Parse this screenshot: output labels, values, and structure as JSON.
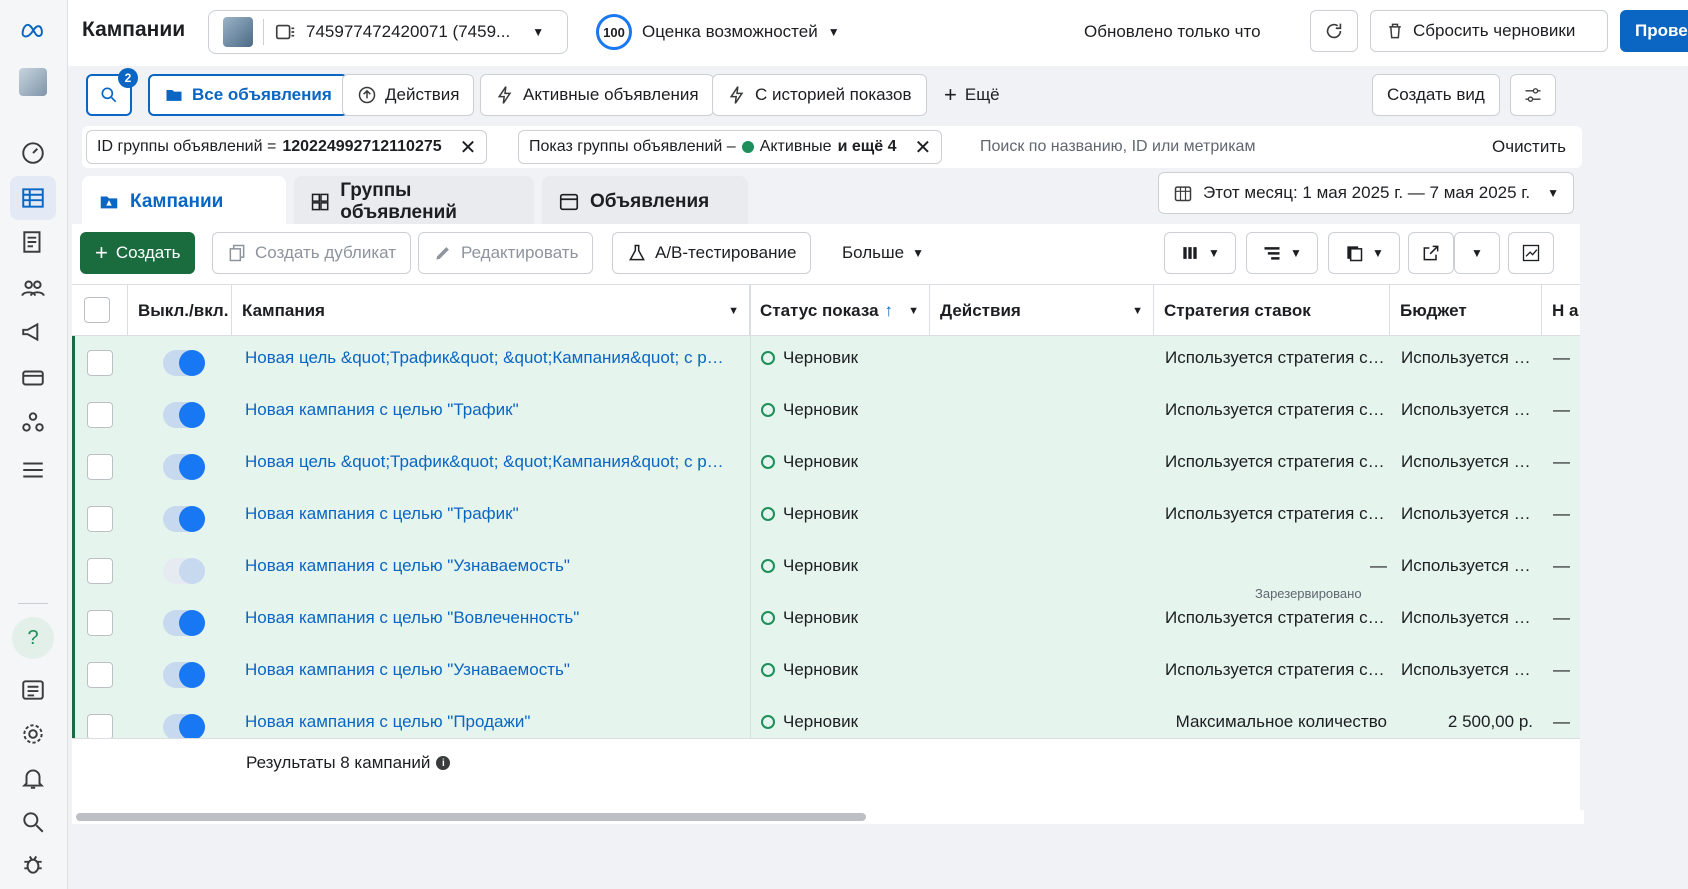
{
  "rail": {
    "items": [
      "meta-logo-icon",
      "account-avatar",
      "dashboard-icon",
      "table-icon",
      "pages-icon",
      "audience-icon",
      "megaphone-icon",
      "billing-icon",
      "business-icon",
      "menu-icon",
      "help-icon",
      "news-icon",
      "gear-icon",
      "bell-icon",
      "search-icon",
      "bug-icon"
    ]
  },
  "header": {
    "title": "Кампании",
    "account": "745977472420071 (7459...",
    "score": "100",
    "score_label": "Оценка возможностей",
    "updated": "Обновлено только что",
    "discard_label": "Сбросить черновики",
    "review_label": "Проверит"
  },
  "views": {
    "search_badge": "2",
    "chips": [
      "Все объявления",
      "Действия",
      "Активные объявления",
      "С историей показов",
      "Ещё"
    ],
    "create_view": "Создать вид"
  },
  "filters": {
    "chip1_label": "ID группы объявлений =",
    "chip1_value": "120224992712110275",
    "chip2_label": "Показ группы объявлений –",
    "chip2_active": "Активные",
    "chip2_more": "и ещё 4",
    "search_placeholder": "Поиск по названию, ID или метрикам",
    "clear": "Очистить"
  },
  "tabs": [
    "Кампании",
    "Группы объявлений",
    "Объявления"
  ],
  "daterange": "Этот месяц: 1 мая 2025 г. — 7 мая 2025 г.",
  "toolbar": {
    "create": "Создать",
    "duplicate": "Создать дубликат",
    "edit": "Редактировать",
    "ab_test": "A/B-тестирование",
    "more": "Больше"
  },
  "table": {
    "headers": [
      "Выкл./вкл.",
      "Кампания",
      "Статус показа",
      "Действия",
      "Стратегия ставок",
      "Бюджет",
      "Н а"
    ],
    "rows": [
      {
        "name": "Новая цель &quot;Трафик&quot; &quot;Кампания&quot; с реко...",
        "status": "Черновик",
        "strategy": "Используется стратегия ст...",
        "budget": "Используется б...",
        "on": true
      },
      {
        "name": "Новая кампания с целью \"Трафик\"",
        "status": "Черновик",
        "strategy": "Используется стратегия ст...",
        "budget": "Используется б...",
        "on": true
      },
      {
        "name": "Новая цель &quot;Трафик&quot; &quot;Кампания&quot; с реко...",
        "status": "Черновик",
        "strategy": "Используется стратегия ст...",
        "budget": "Используется б...",
        "on": true
      },
      {
        "name": "Новая кампания с целью \"Трафик\"",
        "status": "Черновик",
        "strategy": "Используется стратегия ст...",
        "budget": "Используется б...",
        "on": true
      },
      {
        "name": "Новая кампания с целью \"Узнаваемость\"",
        "status": "Черновик",
        "strategy": "—",
        "strategy_note": "Зарезервировано",
        "budget": "Используется б...",
        "on": false
      },
      {
        "name": "Новая кампания с целью \"Вовлеченность\"",
        "status": "Черновик",
        "strategy": "Используется стратегия ст...",
        "budget": "Используется б...",
        "on": true
      },
      {
        "name": "Новая кампания с целью \"Узнаваемость\"",
        "status": "Черновик",
        "strategy": "Используется стратегия ст...",
        "budget": "Используется б...",
        "on": true
      },
      {
        "name": "Новая кампания с целью \"Продажи\"",
        "status": "Черновик",
        "strategy": "Максимальное количество",
        "budget": "2 500,00 р.",
        "on": true
      }
    ],
    "dash": "—",
    "totals": "Результаты 8 кампаний"
  }
}
